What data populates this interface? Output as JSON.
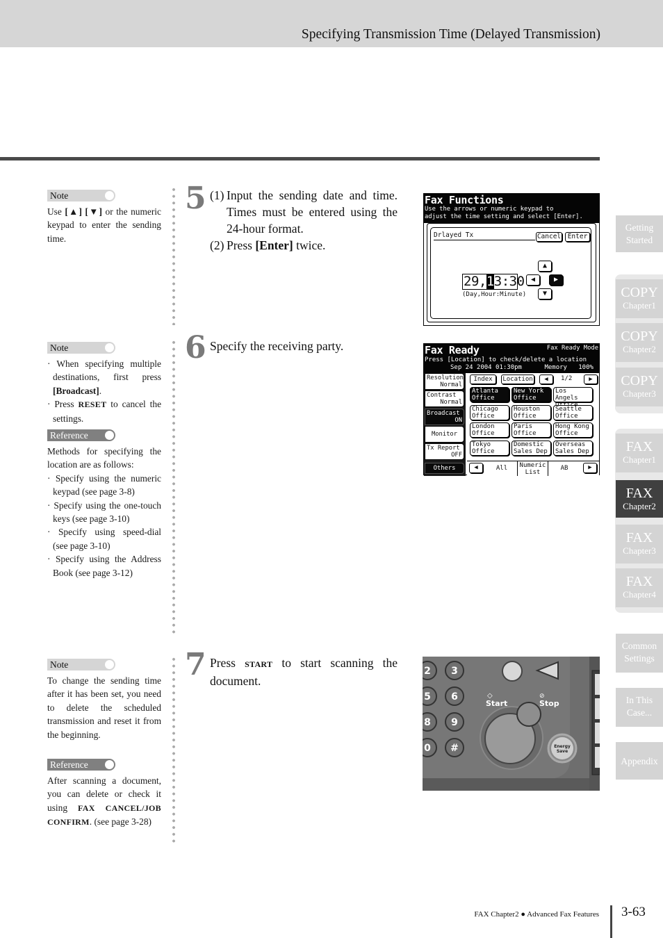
{
  "header": {
    "title": "Specifying Transmission Time (Delayed Transmission)"
  },
  "sidebar_notes": {
    "note1": {
      "label": "Note",
      "text_parts": [
        "Use ",
        "[▲] [▼]",
        " or the numeric keypad to enter the sending time."
      ]
    },
    "note2": {
      "label": "Note",
      "bullets": [
        {
          "pre": "When specifying multiple destinations, first press ",
          "bold": "[Broadcast]",
          "post": "."
        },
        {
          "pre": "Press ",
          "sc": "RESET",
          "post": " to cancel the settings."
        }
      ]
    },
    "ref1": {
      "label": "Reference",
      "intro": "Methods for specifying the location are as follows:",
      "bullets": [
        "Specify using the numeric keypad (see page 3-8)",
        "Specify using the one-touch keys (see page 3-10)",
        "Specify using speed-dial (see page 3-10)",
        "Specify using the Address Book (see page 3-12)"
      ]
    },
    "note3": {
      "label": "Note",
      "text": "To change the sending time after it has been set, you need to delete the scheduled transmission and reset it from the beginning."
    },
    "ref2": {
      "label": "Reference",
      "pre": "After scanning a document, you can delete or check it using ",
      "sc": "FAX CANCEL/JOB CONFIRM",
      "post": ". (see page 3-28)"
    }
  },
  "steps": [
    {
      "number": "5",
      "items": [
        {
          "n": "(1)",
          "text": "Input the sending date and time. Times must be entered using the 24-hour format."
        },
        {
          "n": "(2)",
          "pre": "Press ",
          "bold": "[Enter]",
          "post": " twice."
        }
      ]
    },
    {
      "number": "6",
      "text": "Specify the receiving party."
    },
    {
      "number": "7",
      "pre": "Press ",
      "sc": "START",
      "post": " to start scanning the document."
    }
  ],
  "screen_fax_functions": {
    "title": "Fax Functions",
    "instruction": "Use the arrows or numeric keypad to\nadjust the time setting and select [Enter].",
    "dialog_title": "Drlayed Tx",
    "cancel_label": "Cancel",
    "enter_label": "Enter",
    "time_day": "29,",
    "time_cursor": "1",
    "time_rest": "3:30",
    "time_hint": "(Day,Hour:Minute)",
    "arrows": {
      "up": "▲",
      "down": "▼",
      "left": "◀",
      "right": "▶"
    }
  },
  "screen_fax_ready": {
    "title": "Fax Ready",
    "mode": "Fax Ready Mode",
    "instruction": "Press [Location] to check/delete a location",
    "status_line": "Sep 24 2004 01:30pm      Memory   100%",
    "side_buttons": [
      {
        "label": "Resolution",
        "value": "Normal"
      },
      {
        "label": "Contrast",
        "value": "Normal"
      },
      {
        "label": "Broadcast",
        "value": "ON"
      },
      {
        "label": "Monitor",
        "value": ""
      },
      {
        "label": "Tx Report",
        "value": "OFF"
      },
      {
        "label": "Others",
        "value": ""
      }
    ],
    "index_label": "Index",
    "location_label": "Location",
    "page_indicator": "1/2",
    "locations": [
      [
        "Atlanta",
        "Office"
      ],
      [
        "New York",
        "Office"
      ],
      [
        "Los Angels",
        "Office"
      ],
      [
        "Chicago",
        "Office"
      ],
      [
        "Houston",
        "Office"
      ],
      [
        "Seattle",
        "Office"
      ],
      [
        "London",
        "Office"
      ],
      [
        "Paris",
        "Office"
      ],
      [
        "Hong Kong",
        "Office"
      ],
      [
        "Tokyo",
        "Office"
      ],
      [
        "Domestic",
        "Sales Dep"
      ],
      [
        "Overseas",
        "Sales Dep"
      ]
    ],
    "bottom_tabs": [
      "All",
      "Numeric List",
      "AB"
    ]
  },
  "panel_photo": {
    "keys": [
      "2",
      "3",
      "5",
      "6",
      "8",
      "9",
      "0",
      "#"
    ],
    "start_label": "Start",
    "stop_label": "Stop",
    "energy_save_label": "Energy Save"
  },
  "chapter_tabs": [
    {
      "big": "Getting",
      "small": "Started",
      "style": "two"
    },
    {
      "big": "COPY",
      "small": "Chapter1"
    },
    {
      "big": "COPY",
      "small": "Chapter2"
    },
    {
      "big": "COPY",
      "small": "Chapter3"
    },
    {
      "big": "FAX",
      "small": "Chapter1"
    },
    {
      "big": "FAX",
      "small": "Chapter2",
      "active": true
    },
    {
      "big": "FAX",
      "small": "Chapter3"
    },
    {
      "big": "FAX",
      "small": "Chapter4"
    },
    {
      "big": "Common",
      "small": "Settings",
      "style": "two"
    },
    {
      "big": "In This",
      "small": "Case...",
      "style": "two"
    },
    {
      "big": "Appendix",
      "small": "",
      "style": "one"
    }
  ],
  "footer": {
    "chapter": "FAX Chapter2",
    "section": "Advanced Fax Features",
    "page": "3-63"
  }
}
